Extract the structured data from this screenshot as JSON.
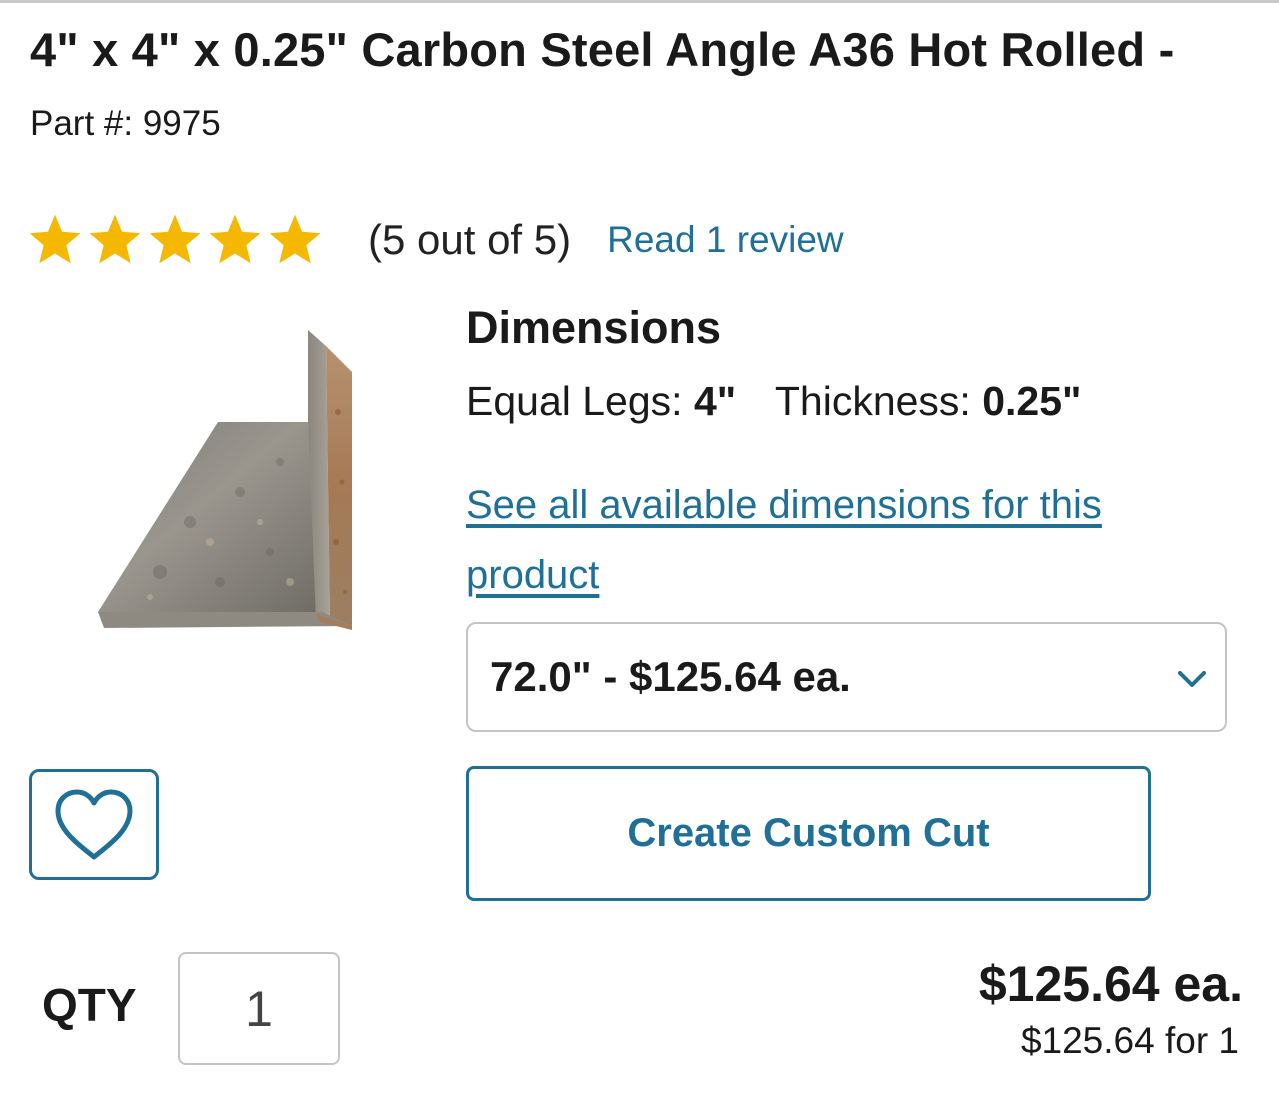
{
  "product": {
    "title": "4\" x 4\" x 0.25\" Carbon Steel Angle A36 Hot Rolled -",
    "part_number": "Part #: 9975"
  },
  "rating": {
    "stars": 5,
    "text": "(5 out of 5)",
    "review_link": "Read 1 review",
    "star_color": "#f5b800"
  },
  "dimensions": {
    "heading": "Dimensions",
    "equal_legs_label": "Equal Legs:",
    "equal_legs_value": "4\"",
    "thickness_label": "Thickness:",
    "thickness_value": "0.25\"",
    "see_all_link": "See all available dimensions for this product"
  },
  "length_select": {
    "selected": "72.0\" - $125.64 ea.",
    "icon": "chevron-down-icon"
  },
  "favorite": {
    "icon": "heart-icon"
  },
  "custom_cut": {
    "label": "Create Custom Cut"
  },
  "quantity": {
    "label": "QTY",
    "value": "1"
  },
  "price": {
    "each": "$125.64 ea.",
    "total": "$125.64 for 1"
  },
  "colors": {
    "accent": "#1f6f96",
    "border": "#c4c4c4"
  }
}
